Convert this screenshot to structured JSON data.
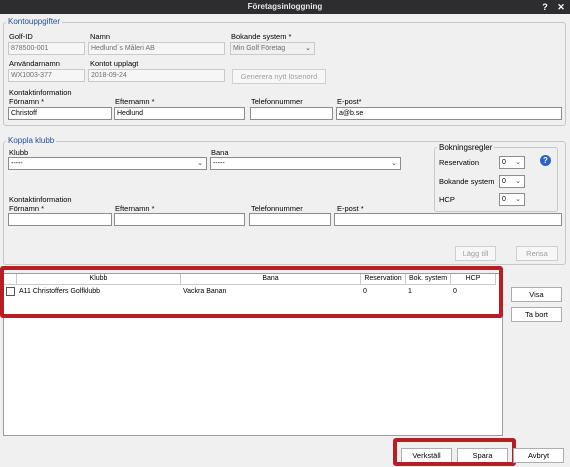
{
  "window": {
    "title": "Företagsinloggning",
    "help_glyph": "?",
    "close_glyph": "✕"
  },
  "kontouppgifter": {
    "legend": "Kontouppgifter",
    "golf_id_label": "Golf-ID",
    "golf_id_value": "878500-001",
    "namn_label": "Namn",
    "namn_value": "Hedlund´s Måleri AB",
    "bokande_system_label": "Bokande system *",
    "bokande_system_value": "Min Golf Företag",
    "anvandarnamn_label": "Användarnamn",
    "anvandarnamn_value": "WX1003-377",
    "kontot_upplagt_label": "Kontot upplagt",
    "kontot_upplagt_value": "2018-09-24",
    "generera_label": "Generera nytt lösenord",
    "kontaktinfo_label": "Kontaktinformation",
    "fornamn_label": "Förnamn *",
    "fornamn_value": "Christoff",
    "efternamn_label": "Efternamn *",
    "efternamn_value": "Hedlund",
    "telefon_label": "Telefonnummer",
    "telefon_value": "",
    "epost_label": "E-post*",
    "epost_value": "a@b.se"
  },
  "koppla_klubb": {
    "legend": "Koppla klubb",
    "klubb_label": "Klubb",
    "klubb_value": "-----",
    "bana_label": "Bana",
    "bana_value": "-----",
    "kontaktinfo_label": "Kontaktinformation",
    "fornamn_label": "Förnamn *",
    "efternamn_label": "Efternamn *",
    "telefon_label": "Telefonnummer",
    "epost_label": "E-post *",
    "lagg_till_label": "Lägg till",
    "rensa_label": "Rensa",
    "bokningsregler": {
      "legend": "Bokningsregler",
      "reservation_label": "Reservation",
      "reservation_value": "0",
      "bokande_system_label": "Bokande system",
      "bokande_system_value": "0",
      "hcp_label": "HCP",
      "hcp_value": "0"
    }
  },
  "table": {
    "columns": [
      "Klubb",
      "Bana",
      "Reservation",
      "Bok. system",
      "HCP"
    ],
    "rows": [
      {
        "klubb": "A11 Christoffers Golfklubb",
        "bana": "Vackra Banan",
        "reservation": "0",
        "bok_system": "1",
        "hcp": "0"
      }
    ]
  },
  "side_buttons": {
    "visa": "Visa",
    "ta_bort": "Ta bort"
  },
  "footer_buttons": {
    "verkstall": "Verkställ",
    "spara": "Spara",
    "avbryt": "Avbryt"
  },
  "colors": {
    "highlight": "#b81d24",
    "legend_text": "#1f4e9c",
    "titlebar": "#2d2d30"
  }
}
